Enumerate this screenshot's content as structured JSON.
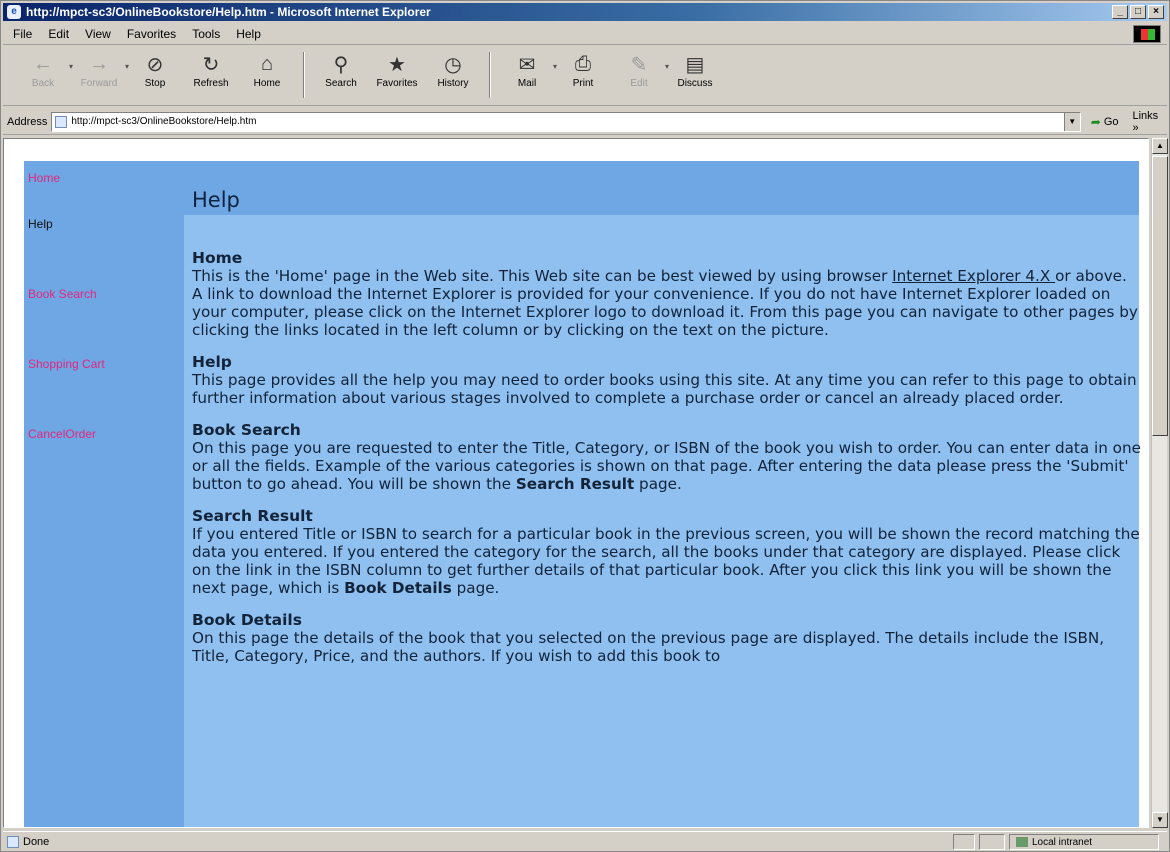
{
  "window": {
    "title": "http://mpct-sc3/OnlineBookstore/Help.htm - Microsoft Internet Explorer",
    "controls": [
      "_",
      "□",
      "×"
    ]
  },
  "menu": [
    {
      "label": "File"
    },
    {
      "label": "Edit"
    },
    {
      "label": "View"
    },
    {
      "label": "Favorites"
    },
    {
      "label": "Tools"
    },
    {
      "label": "Help"
    }
  ],
  "toolbar": {
    "back": "Back",
    "forward": "Forward",
    "stop": "Stop",
    "refresh": "Refresh",
    "home": "Home",
    "search": "Search",
    "favorites": "Favorites",
    "history": "History",
    "mail": "Mail",
    "print": "Print",
    "edit": "Edit",
    "discuss": "Discuss"
  },
  "address": {
    "label": "Address",
    "url": "http://mpct-sc3/OnlineBookstore/Help.htm",
    "go": "Go",
    "links": "Links »"
  },
  "nav": {
    "home": "Home",
    "help": "Help",
    "book_search": "Book Search",
    "shopping_cart": "Shopping Cart",
    "cancel_order": "CancelOrder"
  },
  "page": {
    "title": "Help",
    "sections": {
      "home": {
        "heading": "Home",
        "pre": "This is the 'Home' page in the Web site. This Web site can be best viewed by using browser ",
        "link": "Internet Explorer 4.X ",
        "post": "or above. A link to download the Internet Explorer is provided for your convenience. If you do not have Internet Explorer loaded on your computer, please click on the Internet Explorer logo to download it. From this page you can navigate to other pages by clicking the links located in the left column or by clicking on the text on the picture."
      },
      "help": {
        "heading": "Help",
        "body": "This page provides all the help you may need to order books using this site. At any time you can refer to this page to obtain further information about various stages involved to complete a purchase order or cancel an already placed order."
      },
      "book_search": {
        "heading": "Book Search",
        "body": "On this page you are requested to enter the Title, Category, or ISBN of the book you wish to order. You can enter data in one or all the fields. Example of the various categories is shown on that page. After entering the data please press the 'Submit' button to go ahead. You will be shown the ",
        "bold": "Search Result",
        "tail": " page."
      },
      "search_result": {
        "heading": "Search Result",
        "body": "If you entered Title or ISBN to search for a particular book in the previous screen, you will be shown the record matching the data you entered. If you entered the category for the search, all the books under that category are displayed. Please click on the link in the ISBN column to get further details of that particular book. After you click this link you will be shown the next page, which is ",
        "bold": "Book Details",
        "tail": " page."
      },
      "book_details": {
        "heading": "Book Details",
        "body": "On this page the details of the book that you selected on the previous page are displayed. The details include the ISBN, Title, Category, Price, and the authors. If you wish to add this book to"
      }
    }
  },
  "status": {
    "text": "Done",
    "zone": "Local intranet"
  }
}
